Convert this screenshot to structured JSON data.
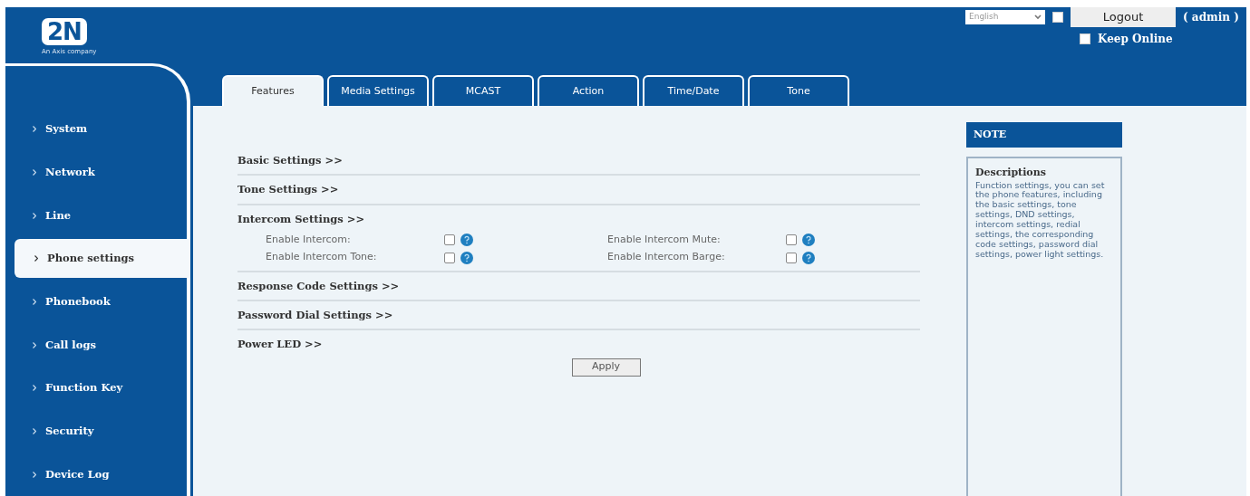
{
  "logo": {
    "mark": "2N",
    "tagline": "An Axis company"
  },
  "topbar": {
    "language": "English",
    "language_checked": false,
    "logout": "Logout",
    "user": "( admin )",
    "keep_online": {
      "label": "Keep Online",
      "checked": false
    }
  },
  "tabs": [
    {
      "label": "Features",
      "selected": true
    },
    {
      "label": "Media Settings",
      "selected": false
    },
    {
      "label": "MCAST",
      "selected": false
    },
    {
      "label": "Action",
      "selected": false
    },
    {
      "label": "Time/Date",
      "selected": false
    },
    {
      "label": "Tone",
      "selected": false
    }
  ],
  "sidebar": {
    "items": [
      {
        "label": "System",
        "selected": false
      },
      {
        "label": "Network",
        "selected": false
      },
      {
        "label": "Line",
        "selected": false
      },
      {
        "label": "Phone settings",
        "selected": true
      },
      {
        "label": "Phonebook",
        "selected": false
      },
      {
        "label": "Call logs",
        "selected": false
      },
      {
        "label": "Function Key",
        "selected": false
      },
      {
        "label": "Security",
        "selected": false
      },
      {
        "label": "Device Log",
        "selected": false
      }
    ]
  },
  "sections": [
    {
      "title": "Basic Settings >>"
    },
    {
      "title": "Tone Settings >>"
    },
    {
      "title": "Intercom Settings >>",
      "fields": [
        {
          "label": "Enable Intercom:",
          "checked": false
        },
        {
          "label": "Enable Intercom Mute:",
          "checked": false
        },
        {
          "label": "Enable Intercom Tone:",
          "checked": false
        },
        {
          "label": "Enable Intercom Barge:",
          "checked": false
        }
      ]
    },
    {
      "title": "Response Code Settings >>"
    },
    {
      "title": "Password Dial Settings >>"
    },
    {
      "title": "Power LED >>"
    }
  ],
  "apply_button": "Apply",
  "note": {
    "title": "NOTE",
    "heading": "Descriptions",
    "text": "Function settings, you can set the phone features, including the basic settings, tone settings, DND settings, intercom settings, redial settings, the corresponding code settings, password dial settings, power light settings."
  }
}
